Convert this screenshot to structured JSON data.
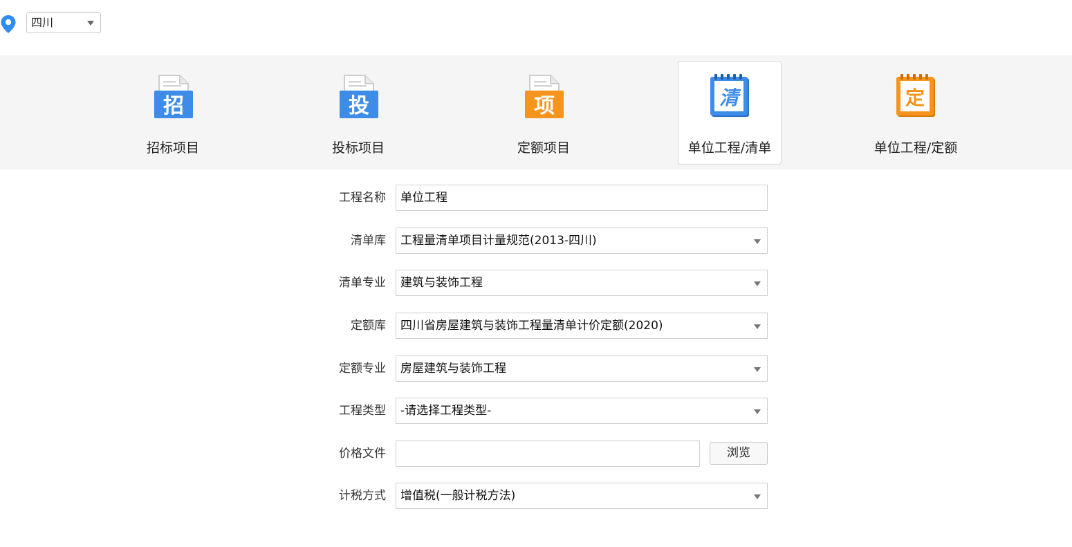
{
  "region": {
    "selected": "四川"
  },
  "project_types": [
    {
      "label": "招标项目",
      "icon_char": "招",
      "icon": "document-zhao-icon",
      "color": "#3d8ce8"
    },
    {
      "label": "投标项目",
      "icon_char": "投",
      "icon": "document-tou-icon",
      "color": "#3d8ce8"
    },
    {
      "label": "定额项目",
      "icon_char": "项",
      "icon": "document-xiang-icon",
      "color": "#f7941d"
    },
    {
      "label": "单位工程/清单",
      "icon_char": "清",
      "icon": "notebook-qing-icon",
      "color": "#3d8ce8",
      "selected": true
    },
    {
      "label": "单位工程/定额",
      "icon_char": "定",
      "icon": "notebook-ding-icon",
      "color": "#f7941d"
    }
  ],
  "form": {
    "project_name": {
      "label": "工程名称",
      "value": "单位工程"
    },
    "bill_library": {
      "label": "清单库",
      "value": "工程量清单项目计量规范(2013-四川)"
    },
    "bill_specialty": {
      "label": "清单专业",
      "value": "建筑与装饰工程"
    },
    "quota_library": {
      "label": "定额库",
      "value": "四川省房屋建筑与装饰工程量清单计价定额(2020)"
    },
    "quota_specialty": {
      "label": "定额专业",
      "value": "房屋建筑与装饰工程"
    },
    "project_type": {
      "label": "工程类型",
      "value": "-请选择工程类型-"
    },
    "price_file": {
      "label": "价格文件",
      "value": "",
      "browse_label": "浏览"
    },
    "tax_method": {
      "label": "计税方式",
      "value": "增值税(一般计税方法)"
    }
  }
}
